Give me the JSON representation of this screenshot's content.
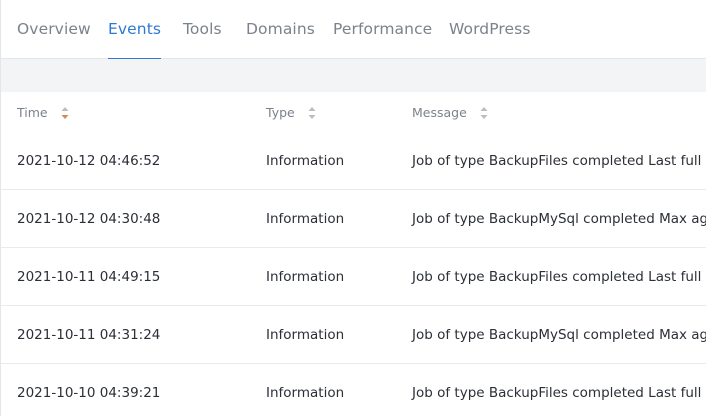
{
  "tabs": [
    {
      "label": "Overview",
      "active": false
    },
    {
      "label": "Events",
      "active": true
    },
    {
      "label": "Tools",
      "active": false
    },
    {
      "label": "Domains",
      "active": false
    },
    {
      "label": "Performance",
      "active": false
    },
    {
      "label": "WordPress",
      "active": false
    }
  ],
  "colors": {
    "accent": "#2f78d4",
    "sort_active": "#d4895a",
    "sort_inactive": "#b9bec6"
  },
  "table": {
    "columns": [
      {
        "label": "Time",
        "sort_icon": "sort-icon-active"
      },
      {
        "label": "Type",
        "sort_icon": "sort-icon"
      },
      {
        "label": "Message",
        "sort_icon": "sort-icon"
      }
    ],
    "rows": [
      {
        "time": "2021-10-12 04:46:52",
        "type": "Information",
        "message": "Job of type BackupFiles completed Last full bac"
      },
      {
        "time": "2021-10-12 04:30:48",
        "type": "Information",
        "message": "Job of type BackupMySql completed Max age (r"
      },
      {
        "time": "2021-10-11 04:49:15",
        "type": "Information",
        "message": "Job of type BackupFiles completed Last full bac"
      },
      {
        "time": "2021-10-11 04:31:24",
        "type": "Information",
        "message": "Job of type BackupMySql completed Max age (r"
      },
      {
        "time": "2021-10-10 04:39:21",
        "type": "Information",
        "message": "Job of type BackupFiles completed Last full bac"
      }
    ]
  }
}
